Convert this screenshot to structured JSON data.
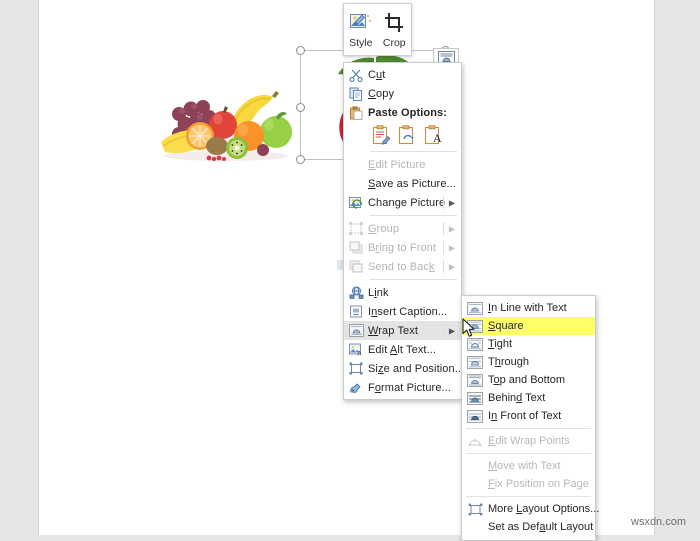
{
  "app": {
    "surface": "word-document-canvas",
    "page_background": "#ffffff",
    "gutter_background": "#e6e6e6"
  },
  "mini_toolbar": {
    "buttons": [
      {
        "label": "Style",
        "icon": "picture-style-icon"
      },
      {
        "label": "Crop",
        "icon": "crop-icon"
      }
    ]
  },
  "selected_object": {
    "name": "strawberry-picture",
    "layout_options_icon": "layout-options-icon",
    "handle_count": 6
  },
  "context_menu": {
    "items": [
      {
        "label": "Cut",
        "icon": "scissors-icon",
        "accel": "t",
        "disabled": false,
        "submenu": false
      },
      {
        "label": "Copy",
        "icon": "copy-icon",
        "accel": "C",
        "disabled": false,
        "submenu": false
      },
      {
        "label": "Paste Options:",
        "icon": "paste-icon",
        "header": true,
        "disabled": false,
        "submenu": false
      },
      {
        "label": "Edit Picture",
        "icon": "none",
        "accel": "E",
        "disabled": true,
        "submenu": false
      },
      {
        "label": "Save as Picture...",
        "icon": "none",
        "accel": "S",
        "disabled": false,
        "submenu": false
      },
      {
        "label": "Change Picture",
        "icon": "change-picture-icon",
        "accel": "g",
        "disabled": false,
        "submenu": true
      },
      {
        "label": "Group",
        "icon": "group-icon",
        "accel": "G",
        "disabled": true,
        "submenu": true
      },
      {
        "label": "Bring to Front",
        "icon": "bring-to-front-icon",
        "accel": "r",
        "disabled": true,
        "submenu": true
      },
      {
        "label": "Send to Back",
        "icon": "send-to-back-icon",
        "accel": "k",
        "disabled": true,
        "submenu": true
      },
      {
        "label": "Link",
        "icon": "link-icon",
        "accel": "i",
        "disabled": false,
        "submenu": false
      },
      {
        "label": "Insert Caption...",
        "icon": "insert-caption-icon",
        "accel": "n",
        "disabled": false,
        "submenu": false
      },
      {
        "label": "Wrap Text",
        "icon": "wrap-text-icon",
        "accel": "W",
        "disabled": false,
        "submenu": true,
        "highlighted": true
      },
      {
        "label": "Edit Alt Text...",
        "icon": "alt-text-icon",
        "accel": "A",
        "disabled": false,
        "submenu": false
      },
      {
        "label": "Size and Position...",
        "icon": "size-position-icon",
        "accel": "z",
        "disabled": false,
        "submenu": false
      },
      {
        "label": "Format Picture...",
        "icon": "format-picture-icon",
        "accel": "o",
        "disabled": false,
        "submenu": false
      }
    ],
    "paste_options": [
      {
        "name": "keep-source-formatting-icon"
      },
      {
        "name": "picture-icon"
      },
      {
        "name": "keep-text-only-icon"
      }
    ]
  },
  "wrap_text_submenu": {
    "items": [
      {
        "label": "In Line with Text",
        "icon": "inline-with-text-icon",
        "accel": "I",
        "disabled": false,
        "selected": false
      },
      {
        "label": "Square",
        "icon": "square-wrap-icon",
        "accel": "S",
        "disabled": false,
        "selected": true
      },
      {
        "label": "Tight",
        "icon": "tight-wrap-icon",
        "accel": "T",
        "disabled": false,
        "selected": false
      },
      {
        "label": "Through",
        "icon": "through-wrap-icon",
        "accel": "h",
        "disabled": false,
        "selected": false
      },
      {
        "label": "Top and Bottom",
        "icon": "top-and-bottom-icon",
        "accel": "o",
        "disabled": false,
        "selected": false
      },
      {
        "label": "Behind Text",
        "icon": "behind-text-icon",
        "accel": "d",
        "disabled": false,
        "selected": false
      },
      {
        "label": "In Front of Text",
        "icon": "in-front-of-text-icon",
        "accel": "n",
        "disabled": false,
        "selected": false
      },
      {
        "label": "Edit Wrap Points",
        "icon": "edit-wrap-points-icon",
        "accel": "E",
        "disabled": true,
        "selected": false
      },
      {
        "label": "Move with Text",
        "icon": "none",
        "accel": "M",
        "disabled": true,
        "selected": false
      },
      {
        "label": "Fix Position on Page",
        "icon": "none",
        "accel": "F",
        "disabled": true,
        "selected": false
      },
      {
        "label": "More Layout Options...",
        "icon": "more-layout-options-icon",
        "accel": "L",
        "disabled": false,
        "selected": false
      },
      {
        "label": "Set as Default Layout",
        "icon": "none",
        "accel": "a",
        "disabled": false,
        "selected": false
      }
    ]
  },
  "watermarks": {
    "overlay_text": "TheWindowsClub",
    "overlay_prefix": "The",
    "corner_text": "wsxdn.com"
  },
  "colors": {
    "highlight_yellow": "#ffff66",
    "menu_hover_gray": "#e4e4e4",
    "disabled_text": "#b4b4b4",
    "menu_border": "#cccccc"
  }
}
